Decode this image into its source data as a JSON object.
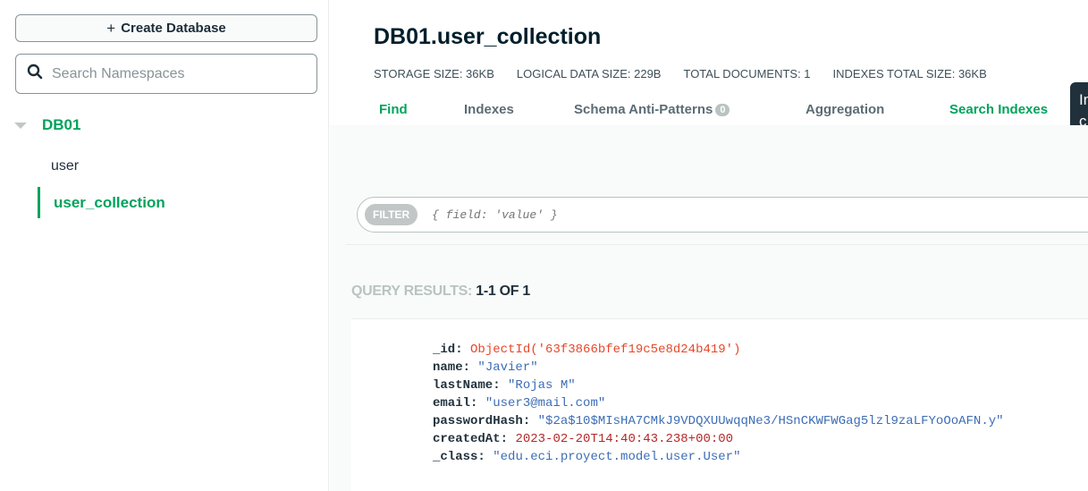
{
  "sidebar": {
    "create_label": "Create Database",
    "search_placeholder": "Search Namespaces",
    "database": "DB01",
    "collections": [
      "user",
      "user_collection"
    ]
  },
  "header": {
    "title": "DB01.user_collection",
    "stats": [
      "STORAGE SIZE: 36KB",
      "LOGICAL DATA SIZE: 229B",
      "TOTAL DOCUMENTS: 1",
      "INDEXES TOTAL SIZE: 36KB"
    ],
    "tabs": {
      "find": "Find",
      "indexes": "Indexes",
      "schema": "Schema Anti-Patterns",
      "schema_badge": "0",
      "aggregation": "Aggregation",
      "search_indexes": "Search Indexes"
    },
    "tooltip_text": "In\nc"
  },
  "query": {
    "filter_label": "FILTER",
    "filter_placeholder": "{ field: 'value' }",
    "results_prefix": "QUERY RESULTS: ",
    "results_count": "1-1 OF 1"
  },
  "document": {
    "fields": [
      {
        "key": "_id",
        "value": "ObjectId('63f3866bfef19c5e8d24b419')",
        "kind": "oid"
      },
      {
        "key": "name",
        "value": "\"Javier\"",
        "kind": "str"
      },
      {
        "key": "lastName",
        "value": "\"Rojas M\"",
        "kind": "str"
      },
      {
        "key": "email",
        "value": "\"user3@mail.com\"",
        "kind": "str"
      },
      {
        "key": "passwordHash",
        "value": "\"$2a$10$MIsHA7CMkJ9VDQXUUwqqNe3/HSnCKWFWGag5lzl9zaLFYoOoAFN.y\"",
        "kind": "str"
      },
      {
        "key": "createdAt",
        "value": "2023-02-20T14:40:43.238+00:00",
        "kind": "date"
      },
      {
        "key": "_class",
        "value": "\"edu.eci.proyect.model.user.User\"",
        "kind": "str"
      }
    ]
  },
  "colors": {
    "accent": "#00a35c",
    "oid": "#e8472a",
    "string": "#3d6db5",
    "date": "#b5282a"
  }
}
